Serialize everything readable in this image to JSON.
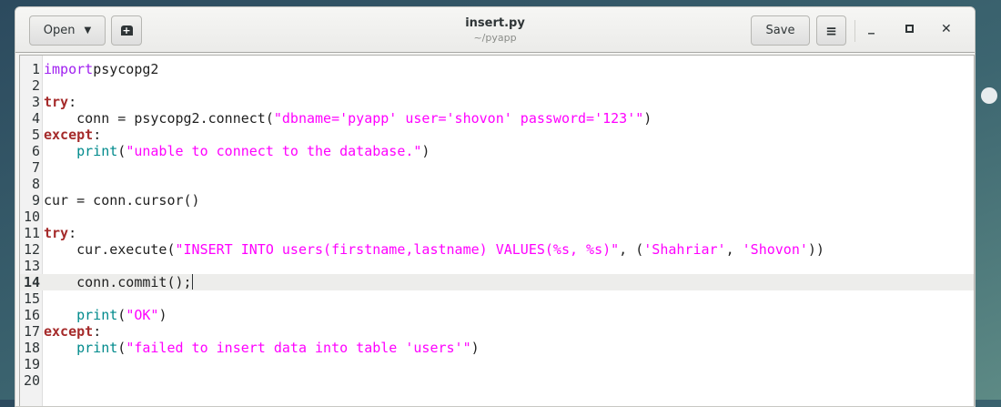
{
  "window": {
    "title": "insert.py",
    "subtitle": "~/pyapp"
  },
  "toolbar": {
    "open_label": "Open",
    "save_label": "Save"
  },
  "editor": {
    "current_line": 14,
    "lines": [
      [
        [
          "imp",
          "import"
        ],
        [
          "",
          "psycopg2"
        ]
      ],
      [],
      [
        [
          "kw",
          "try"
        ],
        [
          "",
          ":"
        ]
      ],
      [
        [
          "",
          "    conn = psycopg2.connect("
        ],
        [
          "str",
          "\"dbname='pyapp' user='shovon' password='123'\""
        ],
        [
          "",
          ")"
        ]
      ],
      [
        [
          "kw",
          "except"
        ],
        [
          "",
          ":"
        ]
      ],
      [
        [
          "fn",
          "    print"
        ],
        [
          "",
          "("
        ],
        [
          "str",
          "\"unable to connect to the database.\""
        ],
        [
          "",
          ")"
        ]
      ],
      [],
      [],
      [
        [
          "",
          "cur = conn.cursor()"
        ]
      ],
      [],
      [
        [
          "kw",
          "try"
        ],
        [
          "",
          ":"
        ]
      ],
      [
        [
          "",
          "    cur.execute("
        ],
        [
          "str",
          "\"INSERT INTO users(firstname,lastname) VALUES(%s, %s)\""
        ],
        [
          "",
          ", ("
        ],
        [
          "str",
          "'Shahriar'"
        ],
        [
          "",
          ", "
        ],
        [
          "str",
          "'Shovon'"
        ],
        [
          "",
          "))"
        ]
      ],
      [],
      [
        [
          "",
          "    conn.commit();"
        ]
      ],
      [],
      [
        [
          "fn",
          "    print"
        ],
        [
          "",
          "("
        ],
        [
          "str",
          "\"OK\""
        ],
        [
          "",
          ")"
        ]
      ],
      [
        [
          "kw",
          "except"
        ],
        [
          "",
          ":"
        ]
      ],
      [
        [
          "fn",
          "    print"
        ],
        [
          "",
          "("
        ],
        [
          "str",
          "\"failed to insert data into table 'users'\""
        ],
        [
          "",
          ")"
        ]
      ],
      [],
      []
    ]
  }
}
